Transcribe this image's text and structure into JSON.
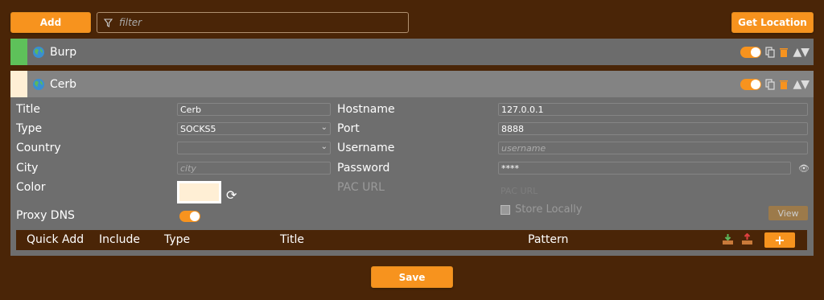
{
  "toolbar": {
    "add_label": "Add",
    "filter_placeholder": "filter",
    "get_location_label": "Get Location"
  },
  "proxies": [
    {
      "name": "Burp",
      "color": "#5ec15a",
      "enabled": true
    },
    {
      "name": "Cerb",
      "color": "#ffefd5",
      "enabled": true
    }
  ],
  "form": {
    "title_label": "Title",
    "title_value": "Cerb",
    "type_label": "Type",
    "type_value": "SOCKS5",
    "country_label": "Country",
    "country_value": "",
    "city_label": "City",
    "city_placeholder": "city",
    "color_label": "Color",
    "color_value": "#ffefd5",
    "proxy_dns_label": "Proxy DNS",
    "proxy_dns_enabled": true,
    "hostname_label": "Hostname",
    "hostname_value": "127.0.0.1",
    "port_label": "Port",
    "port_value": "8888",
    "username_label": "Username",
    "username_placeholder": "username",
    "password_label": "Password",
    "password_value": "****",
    "pac_url_label": "PAC URL",
    "pac_url_placeholder": "PAC URL",
    "store_locally_label": "Store Locally",
    "store_locally_checked": true,
    "view_label": "View"
  },
  "patterns": {
    "columns": [
      "Quick Add",
      "Include",
      "Type",
      "Title",
      "Pattern"
    ],
    "add_label": "+"
  },
  "save_label": "Save",
  "colors": {
    "accent": "#f7931e",
    "background": "#4a2507"
  }
}
